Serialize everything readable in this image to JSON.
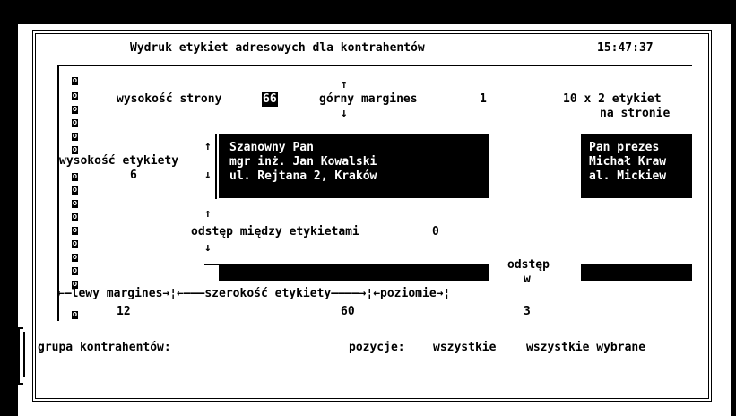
{
  "header": {
    "title": "Wydruk etykiet adresowych dla kontrahentów",
    "time": "15:47:37"
  },
  "page_height": {
    "label": "wysokość strony",
    "value": "66"
  },
  "top_margin": {
    "arrow_up": "↑",
    "label": "górny margines",
    "value": "1",
    "arrow_down": "↓"
  },
  "labels_per_page": {
    "line1": "10 x 2 etykiet",
    "line2": "na stronie"
  },
  "label_height": {
    "label": "wysokość etykiety",
    "value": "6",
    "arrow_up": "↑",
    "arrow_down": "↓"
  },
  "label1": {
    "line1": "Szanowny Pan",
    "line2": "mgr inż. Jan Kowalski",
    "line3": "ul. Rejtana 2, Kraków"
  },
  "label2": {
    "line1": "Pan prezes",
    "line2": "Michał Kraw",
    "line3": "al. Mickiew"
  },
  "vertical_spacing": {
    "arrow_up": "↑",
    "label": "odstęp między etykietami",
    "value": "0",
    "arrow_down": "↓"
  },
  "horizontal_spacing": {
    "line1": "odstęp",
    "line2": "w",
    "line3": "poziomie",
    "value": "3"
  },
  "ruler": {
    "left_margin_label": "←—lewy margines→¦←———szerokość etykiety————→¦←poziomie→¦",
    "left_margin_value": "12",
    "label_width_value": "60"
  },
  "pin_glyph": "o",
  "footer": {
    "group_label": "grupa kontrahentów:",
    "items_label": "pozycje:",
    "option_all": "wszystkie",
    "option_all_selected": "wszystkie wybrane"
  }
}
